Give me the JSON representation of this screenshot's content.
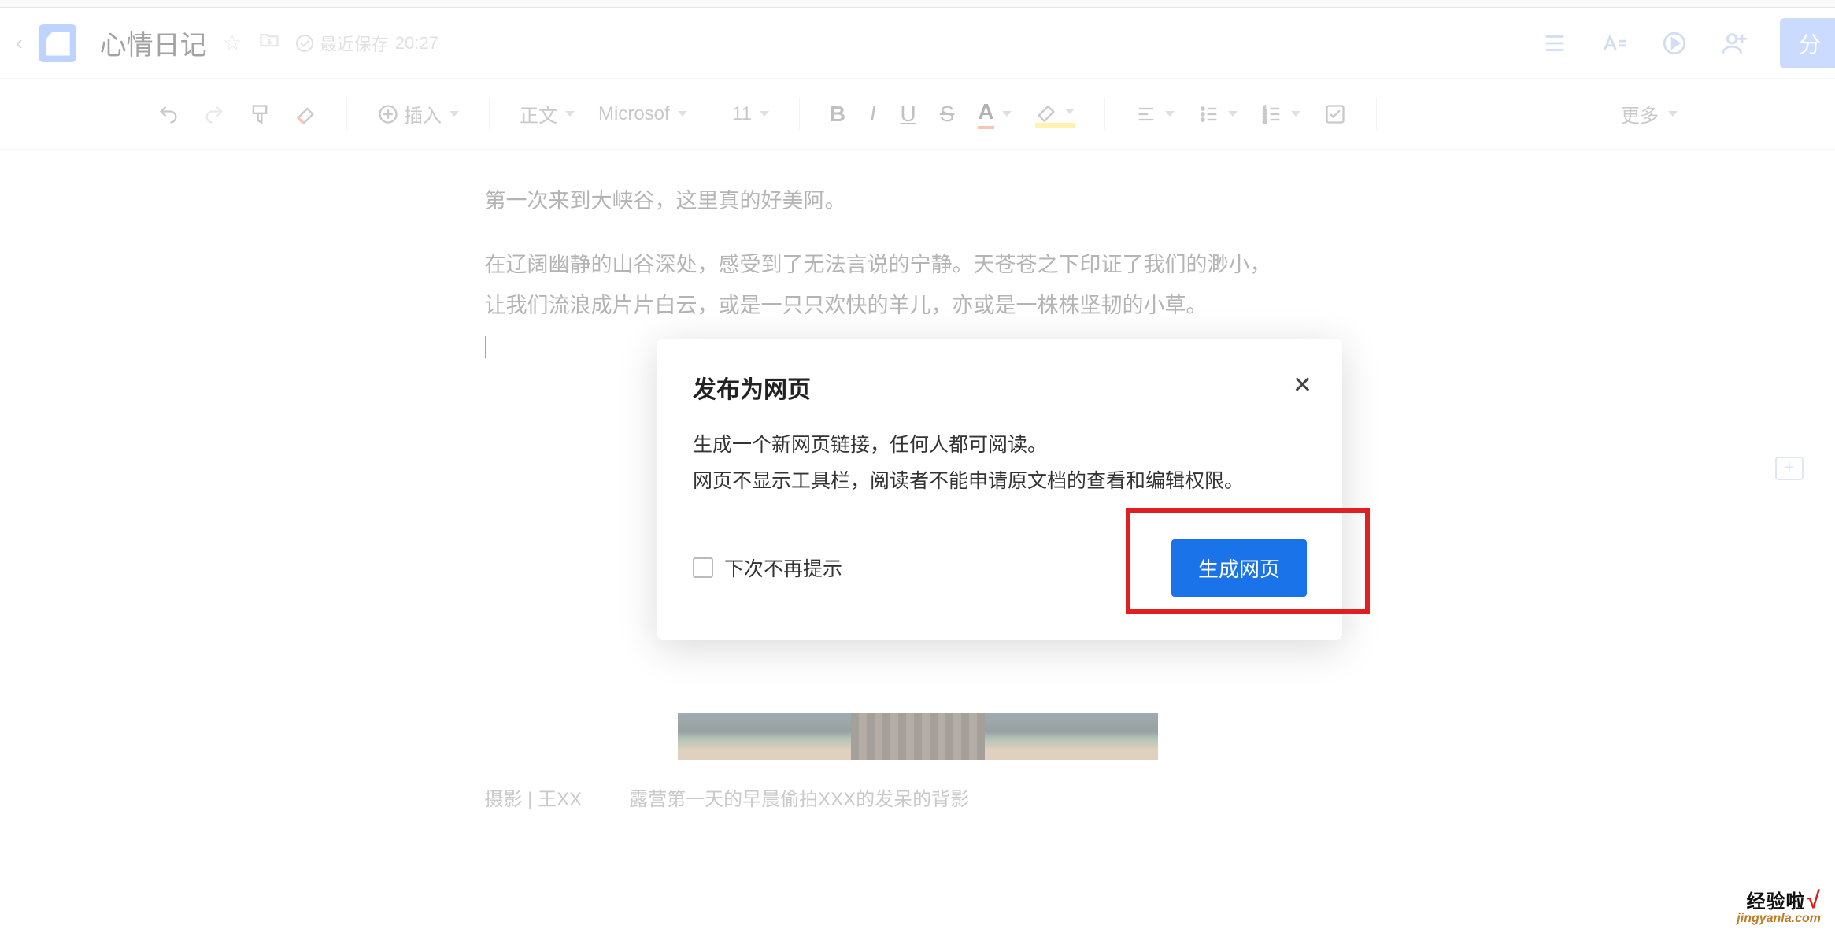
{
  "titlebar": {
    "doc_title": "心情日记",
    "saved_prefix": "最近保存",
    "saved_time": "20:27",
    "share_label": "分"
  },
  "toolbar": {
    "insert_label": "插入",
    "style_label": "正文",
    "font_label": "Microsof",
    "font_size": "11",
    "font_color_glyph": "A",
    "more_label": "更多"
  },
  "document": {
    "line1": "第一次来到大峡谷，这里真的好美阿。",
    "line2": "在辽阔幽静的山谷深处，感受到了无法言说的宁静。天苍苍之下印证了我们的渺小，",
    "line3": "让我们流浪成片片白云，或是一只只欢快的羊儿，亦或是一株株坚韧的小草。",
    "caption_left": "摄影 | 王XX",
    "caption_right": "露营第一天的早晨偷拍XXX的发呆的背影"
  },
  "modal": {
    "title": "发布为网页",
    "desc_line1": "生成一个新网页链接，任何人都可阅读。",
    "desc_line2": "网页不显示工具栏，阅读者不能申请原文档的查看和编辑权限。",
    "checkbox_label": "下次不再提示",
    "confirm_label": "生成网页"
  },
  "watermark": {
    "line1_main": "经验啦",
    "line1_mark": "√",
    "line2": "jingyanla.com"
  },
  "colors": {
    "accent_blue": "#1a73e8",
    "highlight_red": "#e02020",
    "font_color_accent": "#ff7b54",
    "highlight_yellow": "#ffe14d",
    "brand_light_blue": "#8db0ff"
  }
}
